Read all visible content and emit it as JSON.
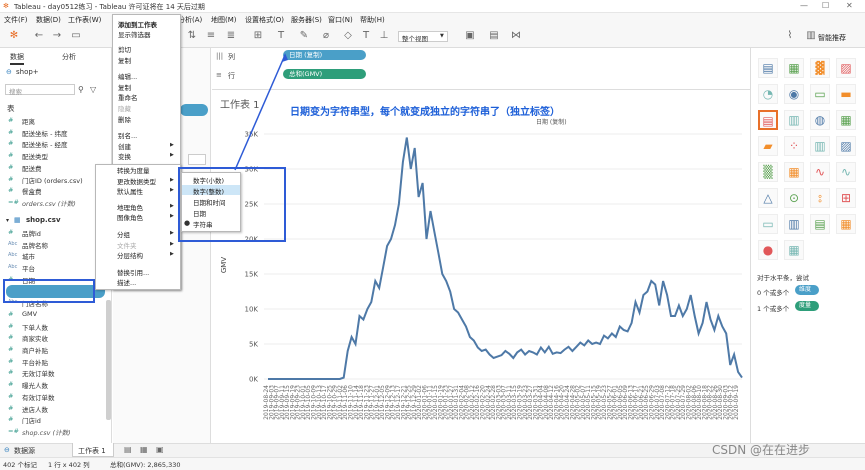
{
  "window": {
    "title": "Tableau - day0512练习 - Tableau 许可证将在 14 天后过期"
  },
  "menu": [
    "文件(F)",
    "数据(D)",
    "工作表(W)",
    "分析(A)",
    "地图(M)",
    "设置格式(O)",
    "服务器(S)",
    "窗口(N)",
    "帮助(H)"
  ],
  "toolbar": {
    "view_select": "整个视图",
    "smart_recommend": "智能推荐"
  },
  "left_panel": {
    "tab_data": "数据",
    "tab_analysis": "分析",
    "datasource": "shop+",
    "search_placeholder": "搜索",
    "tables_header": "表",
    "section_shop": "shop.csv",
    "fields_top": [
      {
        "icon": "#",
        "name": "距离"
      },
      {
        "icon": "#",
        "name": "配送坐标 - 纬度"
      },
      {
        "icon": "#",
        "name": "配送坐标 - 经度"
      },
      {
        "icon": "#",
        "name": "配送类型"
      },
      {
        "icon": "#",
        "name": "配送费"
      },
      {
        "icon": "#",
        "name": "门店ID (orders.csv)"
      },
      {
        "icon": "#",
        "name": "餐盒费"
      },
      {
        "icon": "=#",
        "name": "orders.csv (计数)"
      }
    ],
    "fields_shop": [
      {
        "icon": "#",
        "name": "品牌id"
      },
      {
        "icon": "Abc",
        "name": "品牌名称"
      },
      {
        "icon": "Abc",
        "name": "城市"
      },
      {
        "icon": "Abc",
        "name": "平台"
      },
      {
        "icon": "#",
        "name": "日期"
      },
      {
        "icon": "Abc",
        "name": "日期 (复制)"
      },
      {
        "icon": "Abc",
        "name": "门店名称"
      },
      {
        "icon": "#",
        "name": "GMV"
      },
      {
        "icon": "#",
        "name": "下单人数"
      },
      {
        "icon": "#",
        "name": "商家实收"
      },
      {
        "icon": "#",
        "name": "商户补贴"
      },
      {
        "icon": "#",
        "name": "平台补贴"
      },
      {
        "icon": "#",
        "name": "无效订单数"
      },
      {
        "icon": "#",
        "name": "曝光人数"
      },
      {
        "icon": "#",
        "name": "有效订单数"
      },
      {
        "icon": "#",
        "name": "进店人数"
      },
      {
        "icon": "#",
        "name": "门店id"
      },
      {
        "icon": "=#",
        "name": "shop.csv (计数)"
      }
    ]
  },
  "context_menu": {
    "items": [
      "添加到工作表",
      "显示筛选器",
      "剪切",
      "复制",
      "编辑...",
      "复制",
      "重命名",
      "隐藏",
      "删除",
      "别名...",
      "创建",
      "变换",
      "转换为度量",
      "更改数据类型",
      "默认属性",
      "地理角色",
      "图像角色",
      "分组",
      "文件夹",
      "分层结构",
      "替换引用...",
      "描述..."
    ]
  },
  "submenu": {
    "items": [
      "数字(小数)",
      "数字(整数)",
      "日期和时间",
      "日期",
      "字符串"
    ],
    "checked": "字符串"
  },
  "shelves": {
    "columns_label": "列",
    "rows_label": "行",
    "columns_pill": "日期 (复制)",
    "rows_pill": "总和(GMV)"
  },
  "sheet": {
    "title": "工作表 1",
    "x_header": "日期 (复制)",
    "y_label": "GMV"
  },
  "annotation": "日期变为字符串型，每个就变成独立的字符串了（独立标签）",
  "right_panel": {
    "hint_title": "对于水平条，尝试",
    "line1_prefix": "0 个或多个",
    "line1_pill": "维度",
    "line2_prefix": "1 个或多个",
    "line2_pill": "度量"
  },
  "bottom": {
    "datasource_tab": "数据源",
    "sheet_tab": "工作表 1"
  },
  "status": {
    "marks": "402 个标记",
    "rows_cols": "1 行 x 402 列",
    "sum": "总和(GMV): 2,865,330"
  },
  "watermark": "CSDN @在在进步",
  "colors": {
    "line": "#4e79a7",
    "pill_blue": "#4a9fc8",
    "pill_green": "#2e9e7a",
    "highlight": "#cde6f7"
  },
  "chart_data": {
    "type": "line",
    "ylabel": "GMV",
    "xlabel": "日期 (复制)",
    "ylim": [
      0,
      35000
    ],
    "y_ticks": [
      "0K",
      "5K",
      "10K",
      "15K",
      "20K",
      "25K",
      "30K",
      "35K"
    ],
    "x_ticks": [
      "2019-08-24",
      "2019-09-03",
      "2019-09-07",
      "2019-09-11",
      "2019-09-15",
      "2019-09-19",
      "2019-09-23",
      "2019-10-01",
      "2019-10-05",
      "2019-10-09",
      "2019-10-13",
      "2019-10-17",
      "2019-10-25",
      "2019-10-29",
      "2019-11-02",
      "2019-11-06",
      "2019-11-10",
      "2019-11-14",
      "2019-11-18",
      "2019-11-23",
      "2019-11-27",
      "2019-12-01",
      "2019-12-05",
      "2019-12-09",
      "2019-12-13",
      "2019-12-17",
      "2019-12-21",
      "2019-12-25",
      "2019-12-29",
      "2020-01-02",
      "2020-01-06",
      "2020-01-11",
      "2020-01-15",
      "2020-01-19",
      "2020-01-23",
      "2020-01-27",
      "2020-01-31",
      "2020-02-04",
      "2020-02-08",
      "2020-02-12",
      "2020-02-16",
      "2020-02-20",
      "2020-02-24",
      "2020-02-28",
      "2020-03-03",
      "2020-03-07",
      "2020-03-11",
      "2020-03-15",
      "2020-03-19",
      "2020-03-23",
      "2020-03-27",
      "2020-03-31",
      "2020-04-04",
      "2020-04-08",
      "2020-04-12",
      "2020-04-16",
      "2020-04-20",
      "2020-04-24",
      "2020-04-28",
      "2020-05-02",
      "2020-05-07",
      "2020-05-11",
      "2020-05-15",
      "2020-05-19",
      "2020-05-23",
      "2020-05-27",
      "2020-06-01",
      "2020-06-05",
      "2020-06-09",
      "2020-06-13",
      "2020-06-17",
      "2020-06-21",
      "2020-06-25",
      "2020-06-29",
      "2020-07-03",
      "2020-07-08",
      "2020-07-12",
      "2020-07-18",
      "2020-07-25",
      "2020-07-29",
      "2020-08-02",
      "2020-08-06",
      "2020-08-10",
      "2020-08-18",
      "2020-08-22",
      "2020-08-26",
      "2020-08-30",
      "2020-09-03",
      "2020-09-12",
      "2020-09-19"
    ],
    "values": [
      0,
      0,
      0,
      0,
      0,
      0,
      0,
      0,
      0,
      0,
      0,
      0,
      0,
      0,
      0,
      0,
      0,
      0,
      0,
      0,
      0,
      0,
      0,
      0,
      0,
      0,
      0,
      0,
      0,
      0,
      0,
      0,
      0,
      0,
      0,
      0,
      0,
      0,
      0,
      0,
      0,
      0,
      0,
      0,
      0,
      0,
      0,
      0,
      0,
      0,
      0,
      0,
      0,
      0,
      0,
      0,
      0,
      0,
      0,
      0,
      0,
      0,
      0,
      0,
      0,
      0,
      0,
      0,
      0,
      0,
      0,
      0,
      0,
      0,
      0,
      0,
      0,
      0,
      0,
      0,
      0,
      0,
      0,
      0,
      0,
      0,
      0,
      0,
      0,
      0,
      0,
      0,
      0,
      0,
      0,
      0,
      0,
      0,
      0,
      0,
      0,
      0,
      0,
      0,
      0,
      0,
      0,
      0,
      0,
      0,
      0,
      0,
      0,
      0,
      0,
      0,
      0,
      0,
      0,
      0,
      0,
      0,
      0,
      0,
      0,
      0,
      0,
      0,
      0,
      0,
      0,
      0,
      0,
      0,
      0,
      0,
      0,
      0,
      0,
      0,
      0,
      0,
      0,
      0,
      0,
      0,
      0,
      0,
      0,
      0,
      0,
      0,
      0,
      0,
      0,
      0,
      0,
      0,
      0,
      0,
      0,
      0,
      0,
      0,
      0,
      0,
      0,
      0,
      0,
      0,
      0,
      0,
      0,
      0,
      0,
      0,
      0,
      0,
      0,
      0,
      0,
      0,
      0,
      0,
      0,
      0,
      0,
      0,
      0,
      0,
      0,
      0,
      0,
      0,
      0,
      0,
      0,
      0,
      0,
      0,
      0,
      0,
      0,
      0,
      0,
      0,
      0,
      0,
      0,
      0,
      0,
      0,
      0,
      0,
      0,
      0,
      0,
      0,
      0,
      0,
      0,
      0,
      0,
      0,
      0,
      0,
      0,
      0,
      0,
      0,
      0,
      0,
      0,
      0,
      0,
      0,
      0,
      0,
      0,
      0,
      0,
      0,
      0,
      0,
      0,
      0,
      0,
      0,
      0,
      0,
      0,
      0,
      0,
      0,
      0,
      0,
      0,
      0,
      0,
      0,
      0,
      0,
      0,
      0,
      0,
      0,
      0,
      0,
      0,
      0,
      0,
      0,
      0,
      0,
      0,
      0,
      0,
      0,
      0,
      0,
      0,
      0,
      0,
      0,
      0,
      0,
      0,
      0,
      0,
      0,
      0,
      0,
      0,
      0,
      0,
      0,
      0,
      0,
      0,
      0,
      0,
      0,
      0,
      0,
      0,
      0,
      0,
      0,
      0,
      0,
      0,
      0,
      0,
      0,
      0,
      0,
      0,
      0,
      0,
      0,
      0,
      0,
      0,
      0,
      0,
      0,
      0,
      0,
      0,
      0,
      0,
      0,
      0,
      0,
      0,
      0,
      0,
      0,
      0,
      0,
      0,
      0,
      0,
      0,
      0,
      0,
      0,
      0,
      0,
      0,
      0,
      0,
      0,
      0,
      0,
      0,
      0,
      0,
      0,
      0,
      0,
      0,
      0,
      0,
      0,
      0,
      0,
      0,
      0,
      0,
      0,
      0,
      0,
      0,
      0,
      0,
      0,
      0,
      0,
      0,
      0,
      0,
      0,
      0,
      0,
      0,
      0,
      0,
      0,
      0,
      0,
      0,
      0,
      0,
      0,
      0,
      0,
      0,
      0,
      0,
      0,
      0,
      0,
      0,
      0,
      0,
      0,
      0,
      0,
      0,
      0,
      0,
      0,
      0,
      0,
      0,
      0,
      0,
      0
    ],
    "series": [
      {
        "values": [
          0,
          0,
          0,
          0,
          0,
          200,
          4000,
          6000,
          5000,
          9000,
          8500,
          10000,
          11000,
          14000,
          13000,
          16000,
          19000,
          20000,
          22000,
          25000,
          31000,
          34500,
          30000,
          33000,
          26000,
          28000,
          20000,
          24000,
          21000,
          18000,
          15000,
          14000,
          12500,
          10000,
          9500,
          8500,
          7500,
          6000,
          5500,
          4500,
          4000,
          4200,
          3500,
          3000,
          3200,
          3400,
          4000,
          3600,
          3000,
          3800,
          4200,
          3500,
          4000,
          3800,
          3500,
          4500,
          3800,
          4600,
          3600,
          3800,
          3700,
          4200,
          4600,
          4000,
          4600,
          5200,
          4800,
          5500,
          5000,
          5200,
          5000,
          6200,
          5800,
          6500,
          6000,
          7500,
          7000,
          6800,
          8000,
          11000,
          9500,
          12000,
          12500,
          14000,
          13500,
          10500,
          14000,
          12000,
          9000,
          9000,
          10500,
          9000,
          10000,
          12000,
          9000,
          6500,
          8000,
          11000,
          8500,
          7000,
          9000,
          7500,
          6500,
          2000,
          3500,
          1000,
          200
        ]
      }
    ]
  }
}
